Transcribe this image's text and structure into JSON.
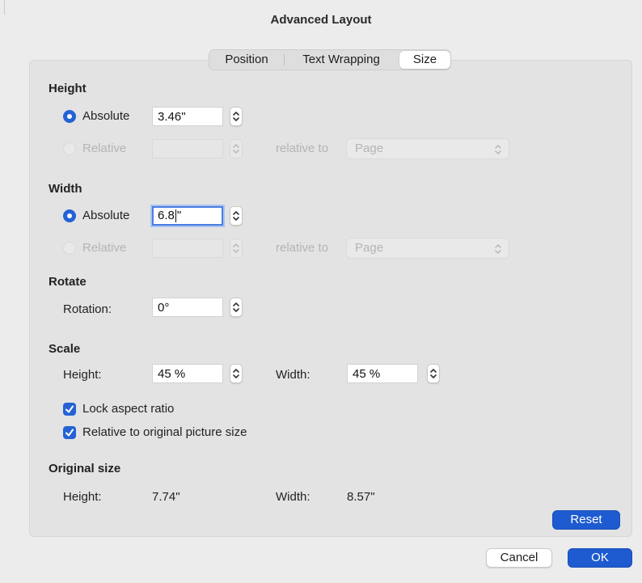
{
  "window": {
    "title": "Advanced Layout"
  },
  "tabs": [
    {
      "label": "Position"
    },
    {
      "label": "Text Wrapping"
    },
    {
      "label": "Size"
    }
  ],
  "height": {
    "heading": "Height",
    "absolute_label": "Absolute",
    "absolute_value": "3.46\"",
    "relative_label": "Relative",
    "relative_value": "",
    "relative_to_label": "relative to",
    "relative_to_value": "Page"
  },
  "width": {
    "heading": "Width",
    "absolute_label": "Absolute",
    "absolute_value_before_caret": "6.8",
    "absolute_value_after_caret": "\"",
    "relative_label": "Relative",
    "relative_value": "",
    "relative_to_label": "relative to",
    "relative_to_value": "Page"
  },
  "rotate": {
    "heading": "Rotate",
    "rotation_label": "Rotation:",
    "rotation_value": "0°"
  },
  "scale": {
    "heading": "Scale",
    "height_label": "Height:",
    "height_value": "45 %",
    "width_label": "Width:",
    "width_value": "45 %",
    "lock_aspect_label": "Lock aspect ratio",
    "lock_aspect_checked": true,
    "relative_original_label": "Relative to original picture size",
    "relative_original_checked": true
  },
  "original_size": {
    "heading": "Original size",
    "height_label": "Height:",
    "height_value": "7.74\"",
    "width_label": "Width:",
    "width_value": "8.57\""
  },
  "buttons": {
    "reset": "Reset",
    "cancel": "Cancel",
    "ok": "OK"
  },
  "colors": {
    "accent": "#1e5bd0",
    "focus_ring": "#4a7fe0",
    "panel": "#e3e3e3",
    "window": "#ececec"
  }
}
